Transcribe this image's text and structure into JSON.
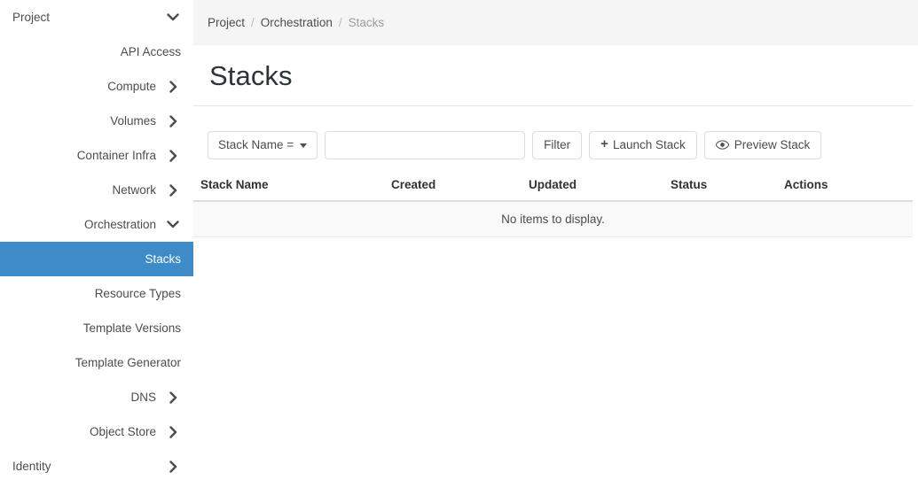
{
  "sidebar": {
    "items": [
      {
        "label": "Project",
        "type": "group-root",
        "icon": "chevron-down-icon",
        "active": false
      },
      {
        "label": "API Access",
        "type": "leaf",
        "icon": "",
        "active": false
      },
      {
        "label": "Compute",
        "type": "group",
        "icon": "chevron-right-icon",
        "active": false
      },
      {
        "label": "Volumes",
        "type": "group",
        "icon": "chevron-right-icon",
        "active": false
      },
      {
        "label": "Container Infra",
        "type": "group",
        "icon": "chevron-right-icon",
        "active": false
      },
      {
        "label": "Network",
        "type": "group",
        "icon": "chevron-right-icon",
        "active": false
      },
      {
        "label": "Orchestration",
        "type": "group",
        "icon": "chevron-down-icon",
        "active": false
      },
      {
        "label": "Stacks",
        "type": "leaf",
        "icon": "",
        "active": true
      },
      {
        "label": "Resource Types",
        "type": "leaf",
        "icon": "",
        "active": false
      },
      {
        "label": "Template Versions",
        "type": "leaf",
        "icon": "",
        "active": false
      },
      {
        "label": "Template Generator",
        "type": "leaf",
        "icon": "",
        "active": false
      },
      {
        "label": "DNS",
        "type": "group",
        "icon": "chevron-right-icon",
        "active": false
      },
      {
        "label": "Object Store",
        "type": "group",
        "icon": "chevron-right-icon",
        "active": false
      },
      {
        "label": "Identity",
        "type": "group-root",
        "icon": "chevron-right-icon",
        "active": false
      }
    ]
  },
  "breadcrumb": {
    "items": [
      "Project",
      "Orchestration",
      "Stacks"
    ],
    "separator": "/"
  },
  "page": {
    "title": "Stacks"
  },
  "toolbar": {
    "filter_type_label": "Stack Name =",
    "filter_type_icon": "caret-down-icon",
    "search_value": "",
    "search_placeholder": "",
    "filter_label": "Filter",
    "launch_stack_label": "Launch Stack",
    "launch_stack_icon": "plus-icon",
    "preview_stack_label": "Preview Stack",
    "preview_stack_icon": "eye-icon"
  },
  "table": {
    "columns": [
      "Stack Name",
      "Created",
      "Updated",
      "Status",
      "Actions"
    ],
    "rows": [],
    "empty_message": "No items to display."
  },
  "colors": {
    "accent": "#3e8bca",
    "breadcrumb_bg": "#f5f5f5",
    "empty_row_bg": "#f9f9f9",
    "text": "#4d4d4d",
    "heading": "#2e3436"
  }
}
